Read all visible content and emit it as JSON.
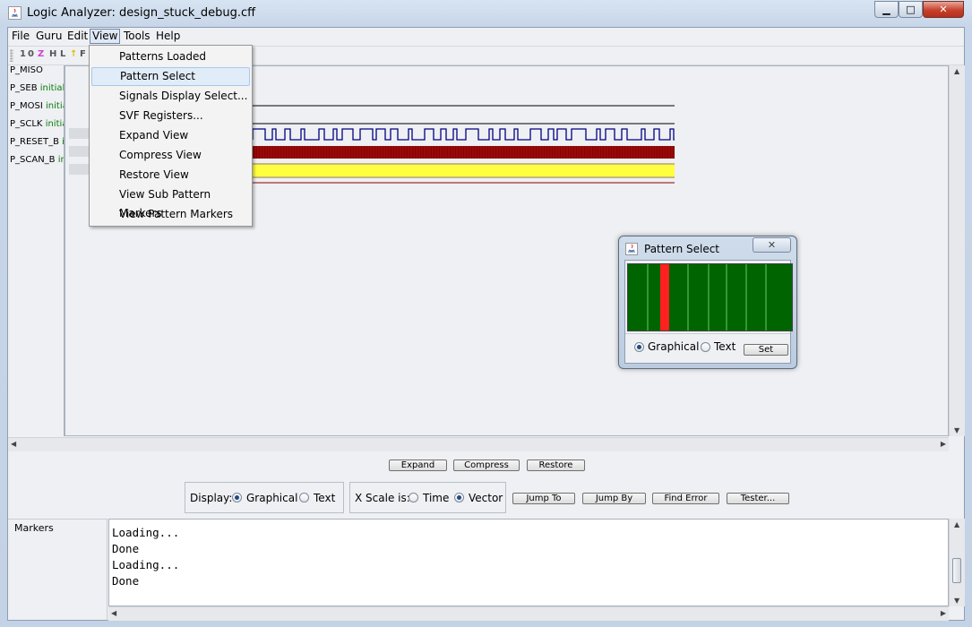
{
  "window": {
    "title": "Logic Analyzer: design_stuck_debug.cff",
    "min_glyph": "▁",
    "max_glyph": "□",
    "close_glyph": "✕"
  },
  "menubar": {
    "items": [
      "File",
      "Guru",
      "Edit",
      "View",
      "Tools",
      "Help"
    ],
    "active": "View"
  },
  "toolbar": {
    "glyphs": [
      {
        "text": "1",
        "color": "#555555"
      },
      {
        "text": "0",
        "color": "#555555"
      },
      {
        "text": "Z",
        "color": "#d040d0"
      },
      {
        "text": "H",
        "color": "#555555"
      },
      {
        "text": "L",
        "color": "#555555"
      },
      {
        "text": "↑",
        "color": "#e0c000"
      },
      {
        "text": "F",
        "color": "#555555"
      }
    ]
  },
  "signals": [
    {
      "name": "P_MISO",
      "suffix": ""
    },
    {
      "name": "P_SEB",
      "suffix": "initial"
    },
    {
      "name": "P_MOSI",
      "suffix": "initial"
    },
    {
      "name": "P_SCLK",
      "suffix": "initial"
    },
    {
      "name": "P_RESET_B",
      "suffix": "i"
    },
    {
      "name": "P_SCAN_B",
      "suffix": "in"
    }
  ],
  "waveform_colors": {
    "line": "#000000",
    "clock": "#000080",
    "bus_red": "#8b0000",
    "bus_yellow": "#ffff40"
  },
  "view_menu": {
    "items": [
      "Patterns Loaded",
      "Pattern Select",
      "Signals Display Select...",
      "SVF Registers...",
      "Expand View",
      "Compress View",
      "Restore View",
      "View Sub Pattern Markers",
      "View Pattern Markers"
    ],
    "highlighted": "Pattern Select"
  },
  "pattern_dialog": {
    "title": "Pattern Select",
    "close_glyph": "✕",
    "options": [
      "Graphical",
      "Text"
    ],
    "selected": "Graphical",
    "set_label": "Set",
    "colors": {
      "background": "#006400",
      "divider": "#60d060",
      "selection": "#ff2020"
    }
  },
  "view_buttons": {
    "expand": "Expand",
    "compress": "Compress",
    "restore": "Restore"
  },
  "display_group": {
    "label": "Display:",
    "options": [
      "Graphical",
      "Text"
    ],
    "selected": "Graphical"
  },
  "xscale_group": {
    "label": "X Scale is:",
    "options": [
      "Time",
      "Vector"
    ],
    "selected": "Vector"
  },
  "action_buttons": {
    "jump_to": "Jump To",
    "jump_by": "Jump By",
    "find_error": "Find Error",
    "tester": "Tester..."
  },
  "markers": {
    "label": "Markers"
  },
  "log": {
    "lines": [
      "Loading...",
      "Done",
      "Loading...",
      "Done"
    ]
  }
}
